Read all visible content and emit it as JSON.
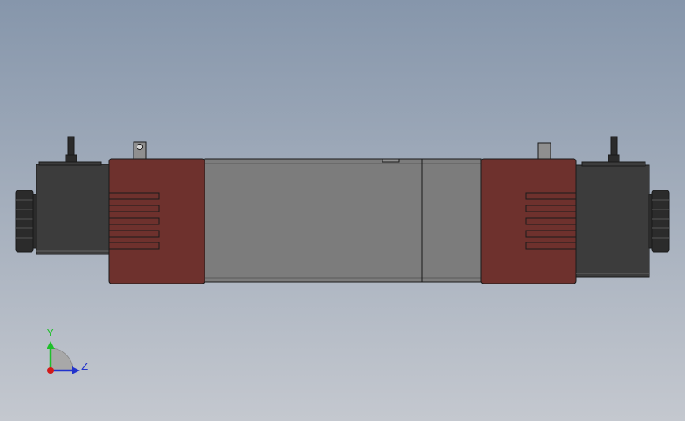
{
  "viewport": {
    "background_top": "#8696ab",
    "background_bottom": "#c4c8cf"
  },
  "model": {
    "solenoid_color": "#3c3c3c",
    "knob_color": "#2b2b2b",
    "cover_color": "#6e312d",
    "body_color": "#7c7c7c",
    "fitting_color": "#8f8f8f",
    "edge_color": "#1a1a1a"
  },
  "triad": {
    "y_label": "Y",
    "z_label": "Z",
    "y_color": "#1fbf2a",
    "z_color": "#2233cc",
    "x_color": "#d11a1a"
  }
}
